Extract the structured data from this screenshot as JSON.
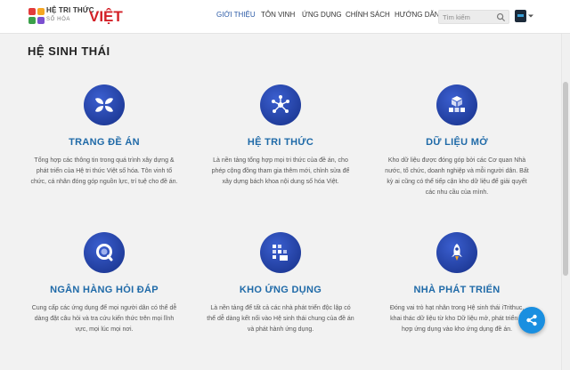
{
  "header": {
    "logo": {
      "line1": "HỆ TRI THỨC",
      "line2": "SỐ HÓA",
      "line3": "VIỆT"
    },
    "nav": [
      "GIỚI THIỆU",
      "TÔN VINH",
      "ỨNG DỤNG",
      "CHÍNH SÁCH",
      "HƯỚNG DẪN"
    ],
    "active_nav": "GIỚI THIỆU",
    "search_placeholder": "Tìm kiếm"
  },
  "section": {
    "title": "HỆ SINH THÁI"
  },
  "cards": [
    {
      "icon": "grid-petals-icon",
      "title": "TRANG ĐỀ ÁN",
      "lines": [
        "Tổng hợp các thông tin trong quá trình xây dựng &",
        "phát triển của Hệ tri thức Việt số hóa. Tôn vinh tổ",
        "chức, cá nhân đóng góp nguồn lực, trí tuệ cho đề án."
      ]
    },
    {
      "icon": "network-nodes-icon",
      "title": "HỆ TRI THỨC",
      "lines": [
        "Là nền tảng tổng hợp mọi tri thức của đề án, cho",
        "phép cộng đồng tham gia thêm mới, chỉnh sửa để",
        "xây dựng bách khoa nội dung số hóa Việt."
      ]
    },
    {
      "icon": "data-cubes-icon",
      "title": "DỮ LIỆU MỞ",
      "lines": [
        "Kho dữ liệu được đóng góp bởi các Cơ quan Nhà",
        "nước, tổ chức, doanh nghiệp và mỗi người dân. Bất",
        "kỳ ai cũng có thể tiếp cận kho dữ liệu để giải quyết",
        "các nhu cầu của mình."
      ]
    },
    {
      "icon": "qa-ring-icon",
      "title": "NGÂN HÀNG HỎI ĐÁP",
      "lines": [
        "Cung cấp các ứng dụng để mọi người dân có thể dễ",
        "dàng đặt câu hỏi và tra cứu kiến thức trên mọi lĩnh",
        "vực, mọi lúc mọi nơi."
      ]
    },
    {
      "icon": "app-blocks-icon",
      "title": "KHO ỨNG DỤNG",
      "lines": [
        "Là nền tảng để tất cả các nhà phát triển độc lập có",
        "thể dễ dàng kết nối vào Hệ sinh thái chung của đề án",
        "và phát hành ứng dụng."
      ]
    },
    {
      "icon": "rocket-code-icon",
      "title": "NHÀ PHÁT TRIỂN",
      "lines": [
        "Đóng vai trò hạt nhân trong Hệ sinh thái iTrithuc,",
        "khai thác dữ liệu từ kho Dữ liệu mở, phát triển &",
        "hợp ứng dụng vào kho ứng dụng đề án."
      ]
    }
  ],
  "colors": {
    "accent": "#1f6aa8",
    "nav_active": "#2b5aa6",
    "icon_circle": "#2544a8",
    "share": "#1a8fe0",
    "logo_red": "#d32027"
  }
}
